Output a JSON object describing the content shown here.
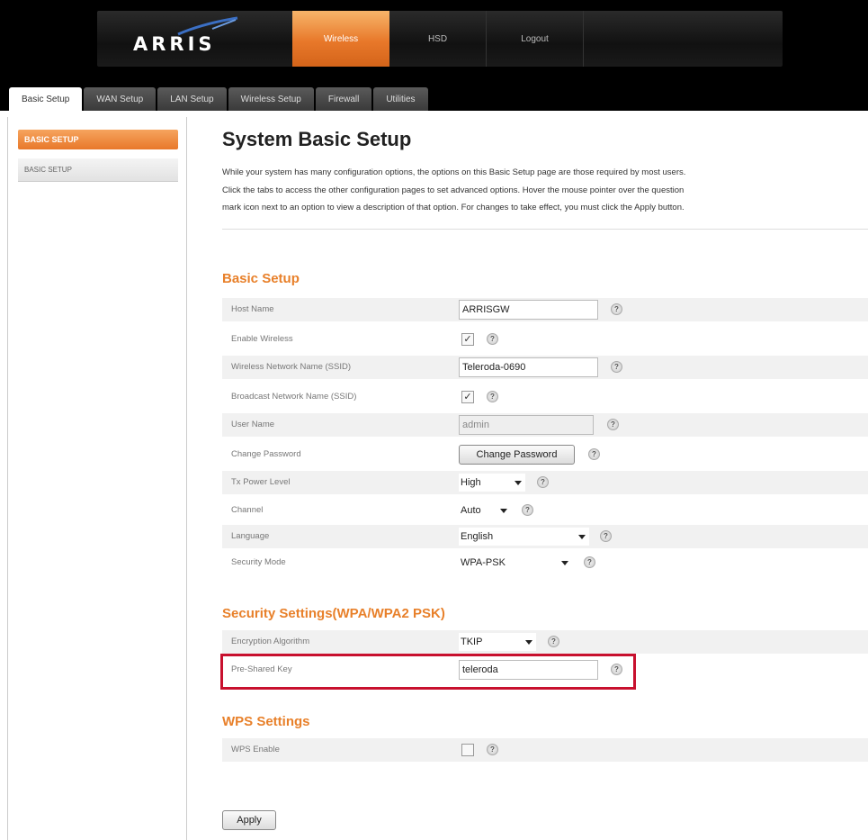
{
  "header": {
    "logo_text": "ARRIS",
    "nav": [
      "Wireless",
      "HSD",
      "Logout"
    ],
    "active_nav": "Wireless",
    "accent": "#e8782a"
  },
  "tabs": [
    "Basic Setup",
    "WAN Setup",
    "LAN Setup",
    "Wireless Setup",
    "Firewall",
    "Utilities"
  ],
  "sidebar": {
    "active_label": "BASIC SETUP",
    "item_label": "BASIC SETUP"
  },
  "main": {
    "title": "System Basic Setup",
    "intro_lines": [
      "While your system has many configuration options, the options on this Basic Setup page are those required by most users.",
      "Click the tabs to access the other configuration pages to set advanced options. Hover the mouse pointer over the question",
      "mark icon next to an option to view a description of that option. For changes to take effect, you must click the Apply button."
    ]
  },
  "basic": {
    "section_title": "Basic Setup",
    "host_name_label": "Host Name",
    "host_name_value": "ARRISGW",
    "enable_wireless_label": "Enable Wireless",
    "enable_wireless_checked": "✓",
    "ssid_label": "Wireless Network Name (SSID)",
    "ssid_value": "Teleroda-0690",
    "broadcast_label": "Broadcast Network Name (SSID)",
    "broadcast_checked": "✓",
    "user_name_label": "User Name",
    "user_name_value": "admin",
    "change_password_label": "Change Password",
    "change_password_button": "Change Password",
    "tx_power_label": "Tx Power Level",
    "tx_power_value": "High",
    "channel_label": "Channel",
    "channel_value": "Auto",
    "language_label": "Language",
    "language_value": "English",
    "security_mode_label": "Security Mode",
    "security_mode_value": "WPA-PSK"
  },
  "security": {
    "section_title": "Security Settings(WPA/WPA2 PSK)",
    "encryption_label": "Encryption Algorithm",
    "encryption_value": "TKIP",
    "psk_label": "Pre-Shared Key",
    "psk_value": "teleroda"
  },
  "wps": {
    "section_title": "WPS Settings",
    "enable_label": "WPS Enable"
  },
  "help_glyph": "?",
  "apply_label": "Apply",
  "highlight_color": "#c8102e"
}
